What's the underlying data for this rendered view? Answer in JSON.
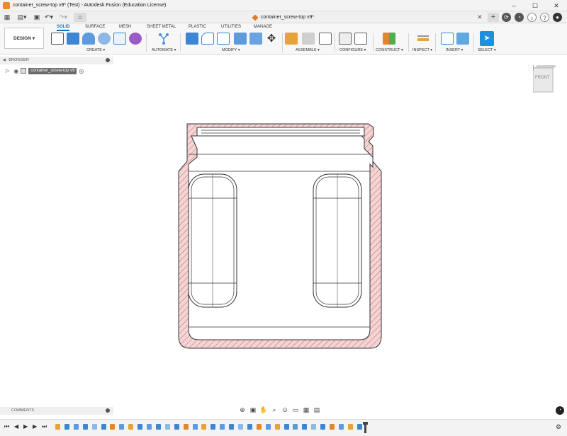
{
  "window": {
    "title": "container_screw-top v9* (Test) - Autodesk Fusion (Education License)",
    "controls": [
      "–",
      "☐",
      "✕"
    ]
  },
  "document_tab": {
    "label": "container_screw-top v9*",
    "close": "✕"
  },
  "ribbon": {
    "workspace_button": "DESIGN ▾",
    "tabs": [
      {
        "label": "SOLID",
        "active": true
      },
      {
        "label": "SURFACE",
        "active": false
      },
      {
        "label": "MESH",
        "active": false
      },
      {
        "label": "SHEET METAL",
        "active": false
      },
      {
        "label": "PLASTIC",
        "active": false
      },
      {
        "label": "UTILITIES",
        "active": false
      },
      {
        "label": "MANAGE",
        "active": false
      }
    ],
    "groups": [
      {
        "label": "CREATE ▾"
      },
      {
        "label": "AUTOMATE ▾"
      },
      {
        "label": "MODIFY ▾"
      },
      {
        "label": "ASSEMBLE ▾"
      },
      {
        "label": "CONFIGURE ▾"
      },
      {
        "label": "CONSTRUCT ▾"
      },
      {
        "label": "INSPECT ▾"
      },
      {
        "label": "INSERT ▾"
      },
      {
        "label": "SELECT ▾"
      }
    ]
  },
  "browser": {
    "header": "BROWSER",
    "root_item": "container_screw-top v9"
  },
  "comments": {
    "header": "COMMENTS"
  },
  "viewcube": {
    "face": "FRONT"
  },
  "colors": {
    "accent": "#0a72c4",
    "section_fill": "#f4d5d5",
    "section_hatch": "#c45c5c",
    "select_button": "#1e90e0"
  }
}
